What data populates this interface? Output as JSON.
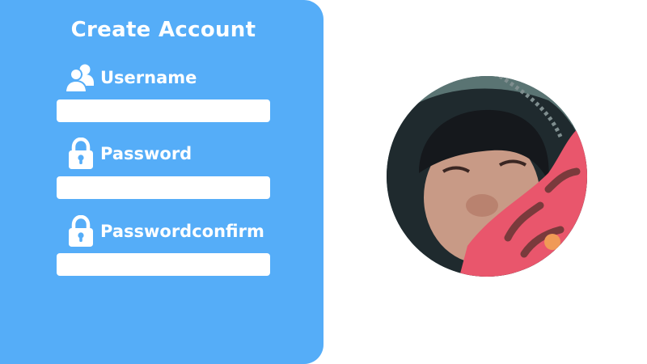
{
  "form": {
    "title": "Create Account",
    "fields": [
      {
        "label": "Username",
        "icon": "users-icon",
        "value": "",
        "placeholder": ""
      },
      {
        "label": "Password",
        "icon": "lock-icon",
        "value": "",
        "placeholder": ""
      },
      {
        "label": "Passwordconfirm",
        "icon": "lock-icon",
        "value": "",
        "placeholder": ""
      }
    ]
  },
  "colors": {
    "panel": "#55adf8",
    "field": "#ffffff",
    "text": "#ffffff"
  },
  "avatar": {
    "icon": "profile-photo"
  }
}
